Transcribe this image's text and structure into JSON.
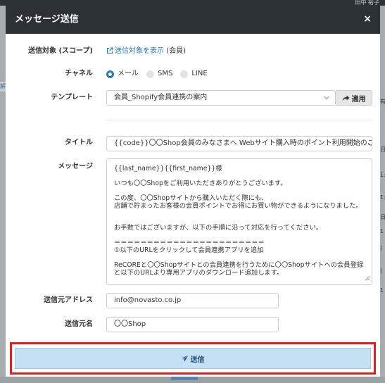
{
  "background": {
    "top_text": "田中 裕子",
    "left_tab": "解",
    "right_fragments": [
      "有",
      "日",
      "1:",
      "1:",
      "日",
      "1",
      "(",
      "(",
      "1"
    ]
  },
  "modal": {
    "title": "メッセージ送信",
    "close_glyph": "×",
    "scope": {
      "label": "送信対象 (スコープ)",
      "link_text": "送信対象を表示",
      "suffix": "(会員)"
    },
    "channel": {
      "label": "チャネル",
      "options": [
        {
          "label": "メール",
          "selected": true
        },
        {
          "label": "SMS",
          "selected": false
        },
        {
          "label": "LINE",
          "selected": false
        }
      ]
    },
    "template": {
      "label": "テンプレート",
      "selected": "会員_Shopify会員連携の案内",
      "apply_label": "適用"
    },
    "title_field": {
      "label": "タイトル",
      "value": "{{code}}〇〇Shop会員のみなさまへ Webサイト購入時のポイント利用開始のご案内"
    },
    "message": {
      "label": "メッセージ",
      "lines": [
        "{{last_name}}{{first_name}}様",
        "",
        "いつも〇〇Shopをご利用いただきありがとうございます。",
        "",
        "この度、〇〇Shopサイトから購入いただく際にも、",
        "店舗で貯まったお客様の会員ポイントでお得にお買い物ができるようになりました。",
        "",
        "",
        "お手数ではございますが、以下の手順に沿って対応を行ってください。",
        "",
        "＝＝＝＝＝＝＝＝＝＝＝＝＝＝＝＝＝＝＝＝＝＝＝",
        "①以下のURLをクリックして会員連携アプリを追加",
        "",
        "ReCOREと〇〇Shopサイトとの会員連携を行うために〇〇Shopサイトへの会員登録",
        "と以下のURLより専用アプリのダウンロード追加します。"
      ]
    },
    "from_address": {
      "label": "送信元アドレス",
      "value": "info@novasto.co.jp"
    },
    "from_name": {
      "label": "送信元名",
      "value": "〇〇Shop"
    },
    "send_label": "送信"
  },
  "colors": {
    "header_bg": "#2c3136",
    "accent": "#2a7ab8",
    "send_bg": "#c4e0f3",
    "highlight": "#e02020"
  }
}
